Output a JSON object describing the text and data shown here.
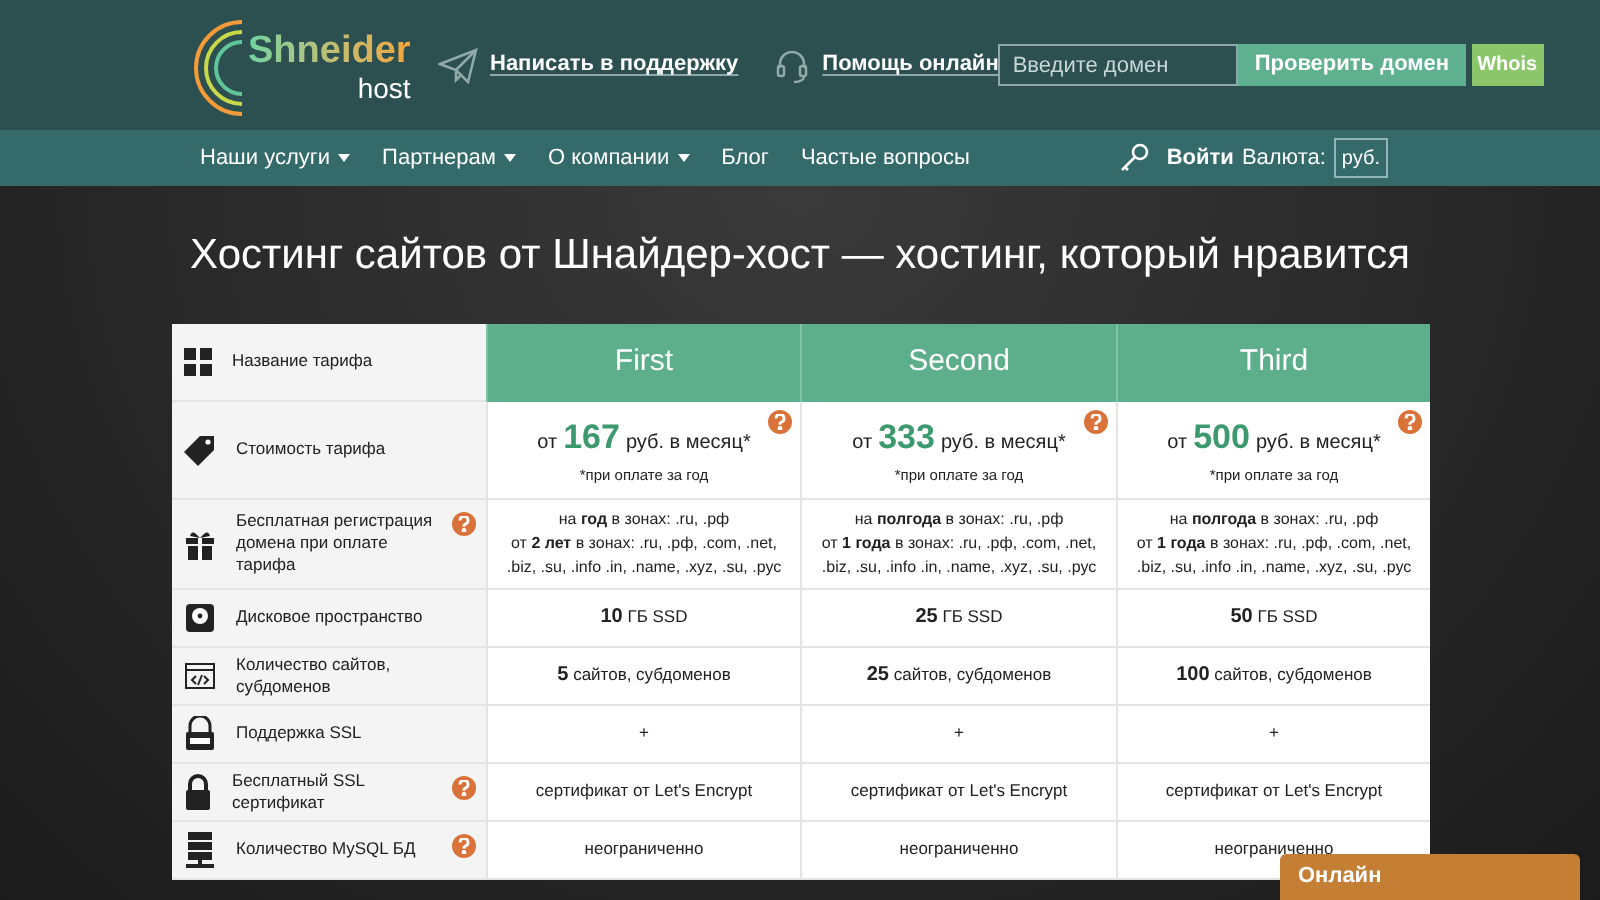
{
  "header": {
    "logo": {
      "name": "Shneider",
      "sub": "host"
    },
    "links": [
      {
        "label": "Написать в поддержку"
      },
      {
        "label": "Помощь онлайн"
      }
    ],
    "domain_search": {
      "placeholder": "Введите домен",
      "button": "Проверить домен",
      "whois": "Whois"
    }
  },
  "nav": {
    "items": [
      {
        "label": "Наши услуги",
        "dropdown": true
      },
      {
        "label": "Партнерам",
        "dropdown": true
      },
      {
        "label": "О компании",
        "dropdown": true
      },
      {
        "label": "Блог",
        "dropdown": false
      },
      {
        "label": "Частые вопросы",
        "dropdown": false
      }
    ],
    "login": "Войти",
    "currency_label": "Валюта:",
    "currency": "руб."
  },
  "title": "Хостинг сайтов от Шнайдер-хост — хостинг, который нравится",
  "table": {
    "header": {
      "label": "Название тарифа",
      "plans": [
        "First",
        "Second",
        "Third"
      ]
    },
    "rows": [
      {
        "label": "Стоимость тарифа",
        "help": false,
        "kind": "price",
        "cells": [
          {
            "prefix": "от",
            "amount": "167",
            "suffix": "руб. в месяц*",
            "note": "*при оплате за год",
            "help": true
          },
          {
            "prefix": "от",
            "amount": "333",
            "suffix": "руб. в месяц*",
            "note": "*при оплате за год",
            "help": true
          },
          {
            "prefix": "от",
            "amount": "500",
            "suffix": "руб. в месяц*",
            "note": "*при оплате за год",
            "help": true
          }
        ]
      },
      {
        "label": "Бесплатная регистрация домена при оплате тарифа",
        "help": true,
        "kind": "lines",
        "cells": [
          [
            "на **год** в зонах: .ru, .рф",
            "от **2 лет** в зонах: .ru, .рф, .com, .net, .biz, .su, .info .in, .name, .xyz, .su, .рус"
          ],
          [
            "на **полгода** в зонах: .ru, .рф",
            "от **1 года** в зонах: .ru, .рф, .com, .net, .biz, .su, .info .in, .name, .xyz, .su, .рус"
          ],
          [
            "на **полгода** в зонах: .ru, .рф",
            "от **1 года** в зонах: .ru, .рф, .com, .net, .biz, .su, .info .in, .name, .xyz, .su, .рус"
          ]
        ]
      },
      {
        "label": "Дисковое пространство",
        "help": false,
        "kind": "text",
        "cells": [
          "**10** ГБ SSD",
          "**25** ГБ SSD",
          "**50** ГБ SSD"
        ]
      },
      {
        "label": "Количество сайтов, субдоменов",
        "help": false,
        "kind": "text",
        "cells": [
          "**5** сайтов, субдоменов",
          "**25** сайтов, субдоменов",
          "**100** сайтов, субдоменов"
        ]
      },
      {
        "label": "Поддержка SSL",
        "help": false,
        "kind": "text",
        "cells": [
          "+",
          "+",
          "+"
        ]
      },
      {
        "label": "Бесплатный SSL сертификат",
        "help": true,
        "kind": "text",
        "cells": [
          "сертификат от Let's Encrypt",
          "сертификат от Let's Encrypt",
          "сертификат от Let's Encrypt"
        ]
      },
      {
        "label": "Количество MySQL БД",
        "help": true,
        "kind": "text",
        "cells": [
          "неограниченно",
          "неограниченно",
          "неограниченно"
        ]
      }
    ]
  },
  "chat_button": "Онлайн"
}
